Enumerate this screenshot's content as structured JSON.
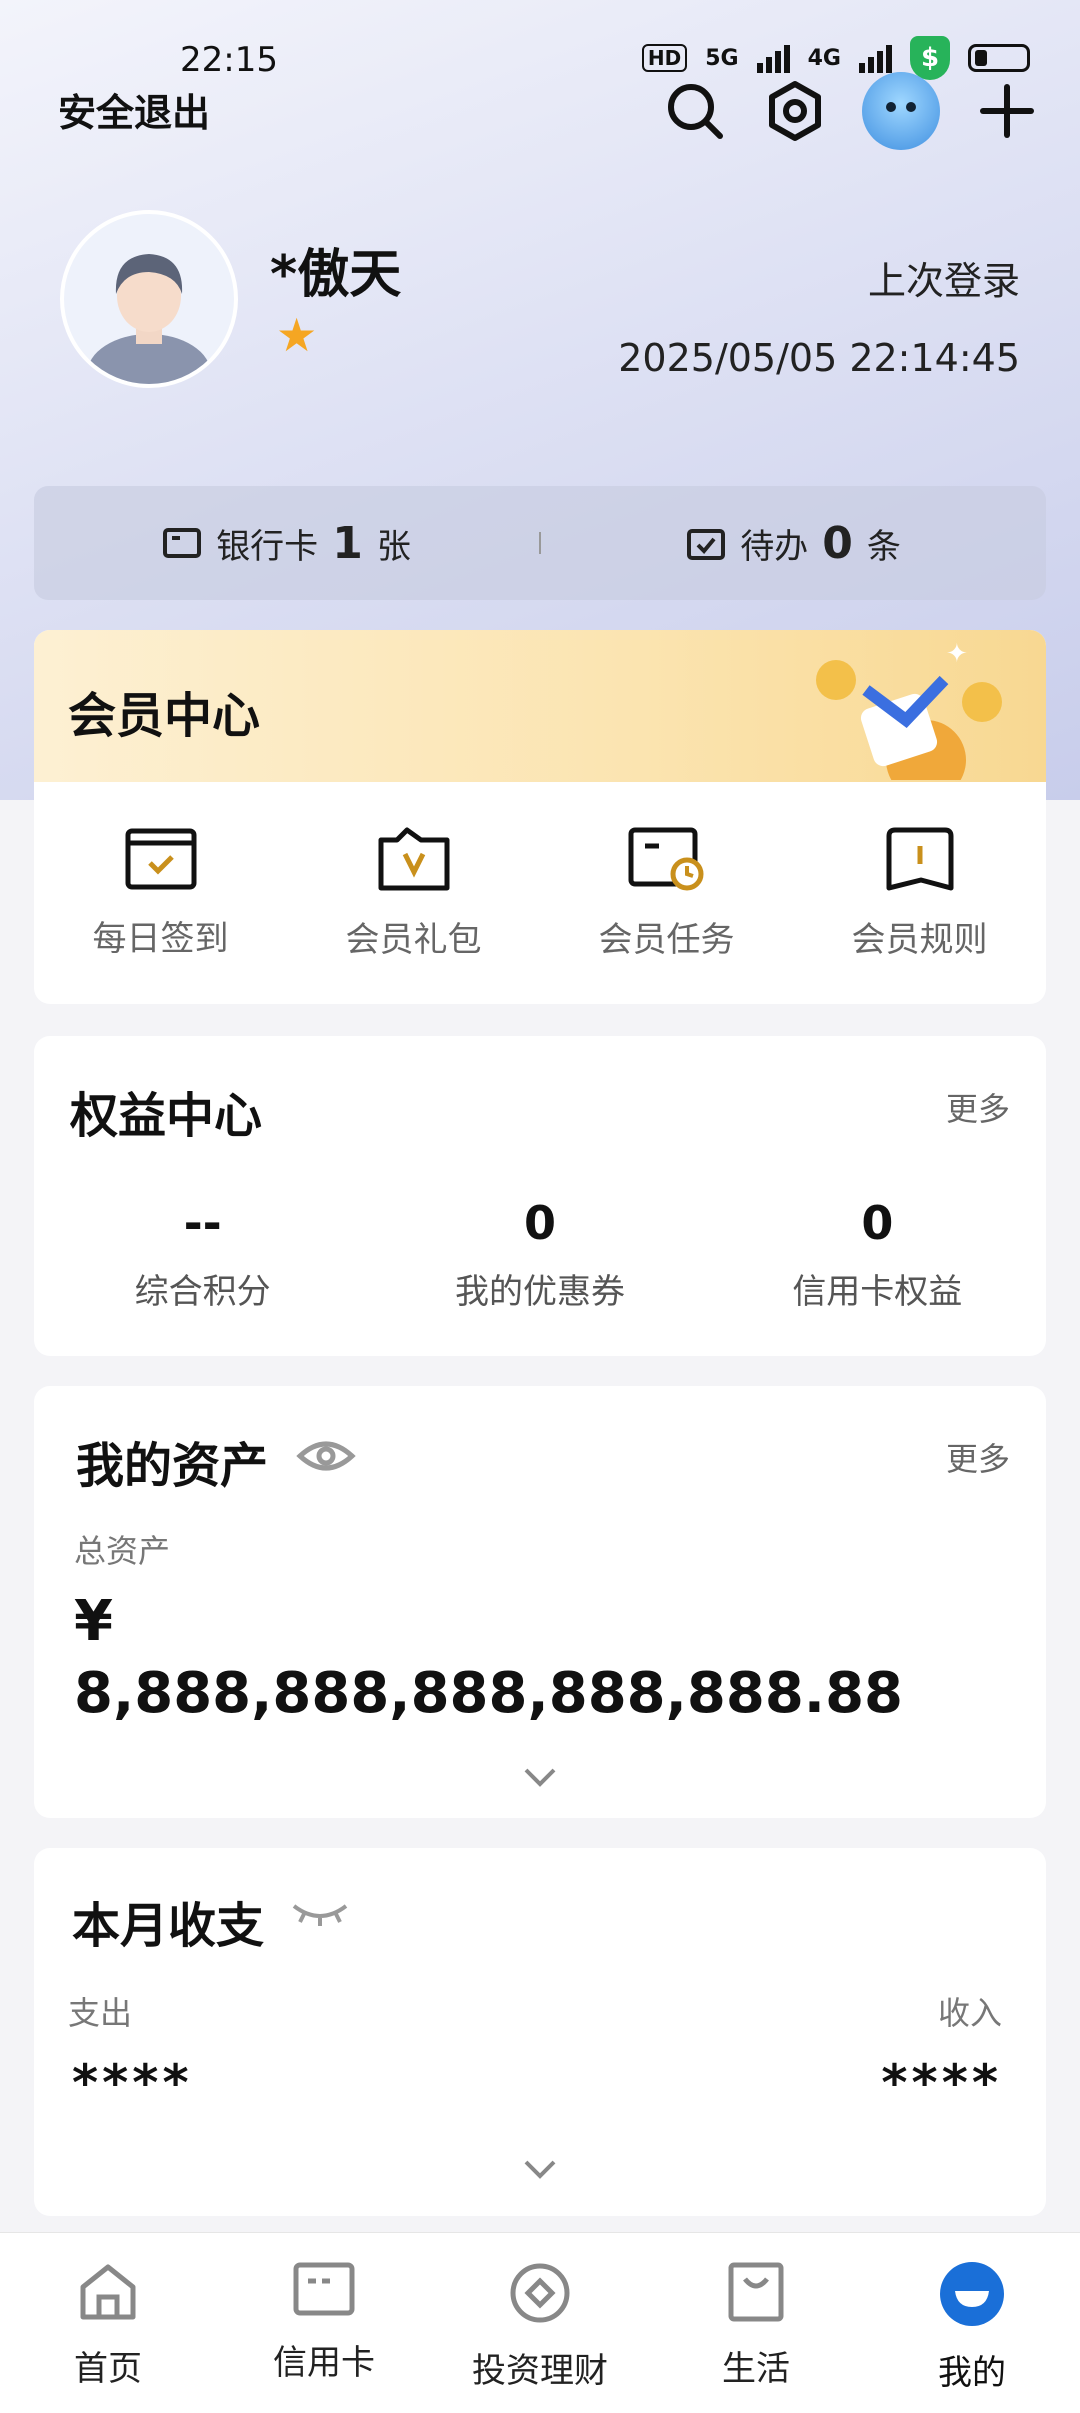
{
  "status_bar": {
    "time": "22:15",
    "hd_badge": "HD",
    "network_1": "5G",
    "network_2": "4G"
  },
  "header": {
    "logout_label": "安全退出",
    "icons": [
      "search-icon",
      "settings-icon",
      "mascot-avatar",
      "plus-icon"
    ]
  },
  "profile": {
    "username": "*傲天",
    "level_star": "★",
    "last_login_label": "上次登录",
    "last_login_time": "2025/05/05 22:14:45"
  },
  "summary": {
    "bank_card_label": "银行卡",
    "bank_card_count": "1",
    "bank_card_unit": "张",
    "todo_label": "待办",
    "todo_count": "0",
    "todo_unit": "条"
  },
  "member_center": {
    "title": "会员中心",
    "items": [
      {
        "label": "每日签到",
        "icon": "calendar-check-icon"
      },
      {
        "label": "会员礼包",
        "icon": "gift-bag-icon"
      },
      {
        "label": "会员任务",
        "icon": "task-clock-icon"
      },
      {
        "label": "会员规则",
        "icon": "rule-book-icon"
      }
    ]
  },
  "rights_center": {
    "title": "权益中心",
    "more": "更多",
    "items": [
      {
        "value": "--",
        "label": "综合积分"
      },
      {
        "value": "0",
        "label": "我的优惠券"
      },
      {
        "value": "0",
        "label": "信用卡权益"
      }
    ]
  },
  "assets": {
    "title": "我的资产",
    "more": "更多",
    "total_label": "总资产",
    "total_amount": "¥ 8,888,888,888,888,888.88"
  },
  "monthly": {
    "title": "本月收支",
    "expense_label": "支出",
    "income_label": "收入",
    "expense_value": "****",
    "income_value": "****"
  },
  "tabbar": {
    "tabs": [
      {
        "label": "首页",
        "icon": "home-icon"
      },
      {
        "label": "信用卡",
        "icon": "credit-card-icon"
      },
      {
        "label": "投资理财",
        "icon": "invest-icon"
      },
      {
        "label": "生活",
        "icon": "shopping-bag-icon"
      },
      {
        "label": "我的",
        "icon": "profile-icon"
      }
    ],
    "active_index": 4
  },
  "colors": {
    "accent_blue": "#1a6fd8",
    "star": "#f5a623",
    "gold": "#c9901c"
  }
}
